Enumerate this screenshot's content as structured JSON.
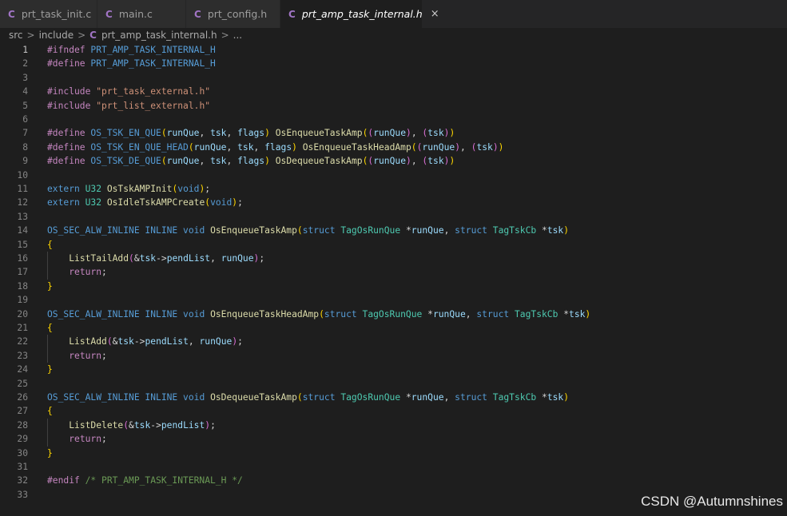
{
  "tabs": [
    {
      "label": "prt_task_init.c",
      "icon": "c-file-icon",
      "active": false
    },
    {
      "label": "main.c",
      "icon": "c-file-icon",
      "active": false
    },
    {
      "label": "prt_config.h",
      "icon": "c-file-icon",
      "active": false
    },
    {
      "label": "prt_amp_task_internal.h",
      "icon": "c-file-icon",
      "active": true,
      "close": "×"
    }
  ],
  "breadcrumb": {
    "segments": [
      "src",
      "include",
      "prt_amp_task_internal.h",
      "..."
    ],
    "separator": ">"
  },
  "colors": {
    "background": "#1e1e1e",
    "preprocessor": "#c586c0",
    "macro": "#569cd6",
    "string": "#ce9178",
    "function": "#dcdcaa",
    "param": "#9cdcfe",
    "type": "#4ec9b0",
    "comment": "#6a9955",
    "plain": "#d4d4d4",
    "bracket_gold": "#ffd700",
    "bracket_purple": "#da70d6",
    "bracket_blue": "#179fff"
  },
  "editor": {
    "current_line": 1,
    "lines": [
      [
        [
          "#ifndef ",
          "pp"
        ],
        [
          "PRT_AMP_TASK_INTERNAL_H",
          "mac"
        ]
      ],
      [
        [
          "#define ",
          "pp"
        ],
        [
          "PRT_AMP_TASK_INTERNAL_H",
          "mac"
        ]
      ],
      [],
      [
        [
          "#include ",
          "pp"
        ],
        [
          "\"prt_task_external.h\"",
          "str"
        ]
      ],
      [
        [
          "#include ",
          "pp"
        ],
        [
          "\"prt_list_external.h\"",
          "str"
        ]
      ],
      [],
      [
        [
          "#define ",
          "pp"
        ],
        [
          "OS_TSK_EN_QUE",
          "mac"
        ],
        [
          "(",
          "bg"
        ],
        [
          "runQue",
          "prm"
        ],
        [
          ", ",
          "pl"
        ],
        [
          "tsk",
          "prm"
        ],
        [
          ", ",
          "pl"
        ],
        [
          "flags",
          "prm"
        ],
        [
          ")",
          "bg"
        ],
        [
          " ",
          "pl"
        ],
        [
          "OsEnqueueTaskAmp",
          "fn"
        ],
        [
          "(",
          "bg"
        ],
        [
          "(",
          "bp"
        ],
        [
          "runQue",
          "prm"
        ],
        [
          ")",
          "bp"
        ],
        [
          ", ",
          "pl"
        ],
        [
          "(",
          "bp"
        ],
        [
          "tsk",
          "prm"
        ],
        [
          ")",
          "bp"
        ],
        [
          ")",
          "bg"
        ]
      ],
      [
        [
          "#define ",
          "pp"
        ],
        [
          "OS_TSK_EN_QUE_HEAD",
          "mac"
        ],
        [
          "(",
          "bg"
        ],
        [
          "runQue",
          "prm"
        ],
        [
          ", ",
          "pl"
        ],
        [
          "tsk",
          "prm"
        ],
        [
          ", ",
          "pl"
        ],
        [
          "flags",
          "prm"
        ],
        [
          ")",
          "bg"
        ],
        [
          " ",
          "pl"
        ],
        [
          "OsEnqueueTaskHeadAmp",
          "fn"
        ],
        [
          "(",
          "bg"
        ],
        [
          "(",
          "bp"
        ],
        [
          "runQue",
          "prm"
        ],
        [
          ")",
          "bp"
        ],
        [
          ", ",
          "pl"
        ],
        [
          "(",
          "bp"
        ],
        [
          "tsk",
          "prm"
        ],
        [
          ")",
          "bp"
        ],
        [
          ")",
          "bg"
        ]
      ],
      [
        [
          "#define ",
          "pp"
        ],
        [
          "OS_TSK_DE_QUE",
          "mac"
        ],
        [
          "(",
          "bg"
        ],
        [
          "runQue",
          "prm"
        ],
        [
          ", ",
          "pl"
        ],
        [
          "tsk",
          "prm"
        ],
        [
          ", ",
          "pl"
        ],
        [
          "flags",
          "prm"
        ],
        [
          ")",
          "bg"
        ],
        [
          " ",
          "pl"
        ],
        [
          "OsDequeueTaskAmp",
          "fn"
        ],
        [
          "(",
          "bg"
        ],
        [
          "(",
          "bp"
        ],
        [
          "runQue",
          "prm"
        ],
        [
          ")",
          "bp"
        ],
        [
          ", ",
          "pl"
        ],
        [
          "(",
          "bp"
        ],
        [
          "tsk",
          "prm"
        ],
        [
          ")",
          "bp"
        ],
        [
          ")",
          "bg"
        ]
      ],
      [],
      [
        [
          "extern ",
          "mac"
        ],
        [
          "U32 ",
          "typ"
        ],
        [
          "OsTskAMPInit",
          "fn"
        ],
        [
          "(",
          "bg"
        ],
        [
          "void",
          "mac"
        ],
        [
          ")",
          "bg"
        ],
        [
          ";",
          "pl"
        ]
      ],
      [
        [
          "extern ",
          "mac"
        ],
        [
          "U32 ",
          "typ"
        ],
        [
          "OsIdleTskAMPCreate",
          "fn"
        ],
        [
          "(",
          "bg"
        ],
        [
          "void",
          "mac"
        ],
        [
          ")",
          "bg"
        ],
        [
          ";",
          "pl"
        ]
      ],
      [],
      [
        [
          "OS_SEC_ALW_INLINE INLINE ",
          "mac"
        ],
        [
          "void ",
          "mac"
        ],
        [
          "OsEnqueueTaskAmp",
          "fn"
        ],
        [
          "(",
          "bg"
        ],
        [
          "struct ",
          "mac"
        ],
        [
          "TagOsRunQue ",
          "typ"
        ],
        [
          "*",
          "pl"
        ],
        [
          "runQue",
          "prm"
        ],
        [
          ", ",
          "pl"
        ],
        [
          "struct ",
          "mac"
        ],
        [
          "TagTskCb ",
          "typ"
        ],
        [
          "*",
          "pl"
        ],
        [
          "tsk",
          "prm"
        ],
        [
          ")",
          "bg"
        ]
      ],
      [
        [
          "{",
          "bg"
        ]
      ],
      [
        [
          "    ",
          "pl"
        ],
        [
          "ListTailAdd",
          "fn"
        ],
        [
          "(",
          "bp"
        ],
        [
          "&",
          "pl"
        ],
        [
          "tsk",
          "prm"
        ],
        [
          "->",
          "pl"
        ],
        [
          "pendList",
          "prm"
        ],
        [
          ", ",
          "pl"
        ],
        [
          "runQue",
          "prm"
        ],
        [
          ")",
          "bp"
        ],
        [
          ";",
          "pl"
        ]
      ],
      [
        [
          "    ",
          "pl"
        ],
        [
          "return",
          "pp"
        ],
        [
          ";",
          "pl"
        ]
      ],
      [
        [
          "}",
          "bg"
        ]
      ],
      [],
      [
        [
          "OS_SEC_ALW_INLINE INLINE ",
          "mac"
        ],
        [
          "void ",
          "mac"
        ],
        [
          "OsEnqueueTaskHeadAmp",
          "fn"
        ],
        [
          "(",
          "bg"
        ],
        [
          "struct ",
          "mac"
        ],
        [
          "TagOsRunQue ",
          "typ"
        ],
        [
          "*",
          "pl"
        ],
        [
          "runQue",
          "prm"
        ],
        [
          ", ",
          "pl"
        ],
        [
          "struct ",
          "mac"
        ],
        [
          "TagTskCb ",
          "typ"
        ],
        [
          "*",
          "pl"
        ],
        [
          "tsk",
          "prm"
        ],
        [
          ")",
          "bg"
        ]
      ],
      [
        [
          "{",
          "bg"
        ]
      ],
      [
        [
          "    ",
          "pl"
        ],
        [
          "ListAdd",
          "fn"
        ],
        [
          "(",
          "bp"
        ],
        [
          "&",
          "pl"
        ],
        [
          "tsk",
          "prm"
        ],
        [
          "->",
          "pl"
        ],
        [
          "pendList",
          "prm"
        ],
        [
          ", ",
          "pl"
        ],
        [
          "runQue",
          "prm"
        ],
        [
          ")",
          "bp"
        ],
        [
          ";",
          "pl"
        ]
      ],
      [
        [
          "    ",
          "pl"
        ],
        [
          "return",
          "pp"
        ],
        [
          ";",
          "pl"
        ]
      ],
      [
        [
          "}",
          "bg"
        ]
      ],
      [],
      [
        [
          "OS_SEC_ALW_INLINE INLINE ",
          "mac"
        ],
        [
          "void ",
          "mac"
        ],
        [
          "OsDequeueTaskAmp",
          "fn"
        ],
        [
          "(",
          "bg"
        ],
        [
          "struct ",
          "mac"
        ],
        [
          "TagOsRunQue ",
          "typ"
        ],
        [
          "*",
          "pl"
        ],
        [
          "runQue",
          "prm"
        ],
        [
          ", ",
          "pl"
        ],
        [
          "struct ",
          "mac"
        ],
        [
          "TagTskCb ",
          "typ"
        ],
        [
          "*",
          "pl"
        ],
        [
          "tsk",
          "prm"
        ],
        [
          ")",
          "bg"
        ]
      ],
      [
        [
          "{",
          "bg"
        ]
      ],
      [
        [
          "    ",
          "pl"
        ],
        [
          "ListDelete",
          "fn"
        ],
        [
          "(",
          "bp"
        ],
        [
          "&",
          "pl"
        ],
        [
          "tsk",
          "prm"
        ],
        [
          "->",
          "pl"
        ],
        [
          "pendList",
          "prm"
        ],
        [
          ")",
          "bp"
        ],
        [
          ";",
          "pl"
        ]
      ],
      [
        [
          "    ",
          "pl"
        ],
        [
          "return",
          "pp"
        ],
        [
          ";",
          "pl"
        ]
      ],
      [
        [
          "}",
          "bg"
        ]
      ],
      [],
      [
        [
          "#endif ",
          "pp"
        ],
        [
          "/* PRT_AMP_TASK_INTERNAL_H */",
          "cmt"
        ]
      ],
      []
    ]
  },
  "watermark": "CSDN @Autumnshines"
}
